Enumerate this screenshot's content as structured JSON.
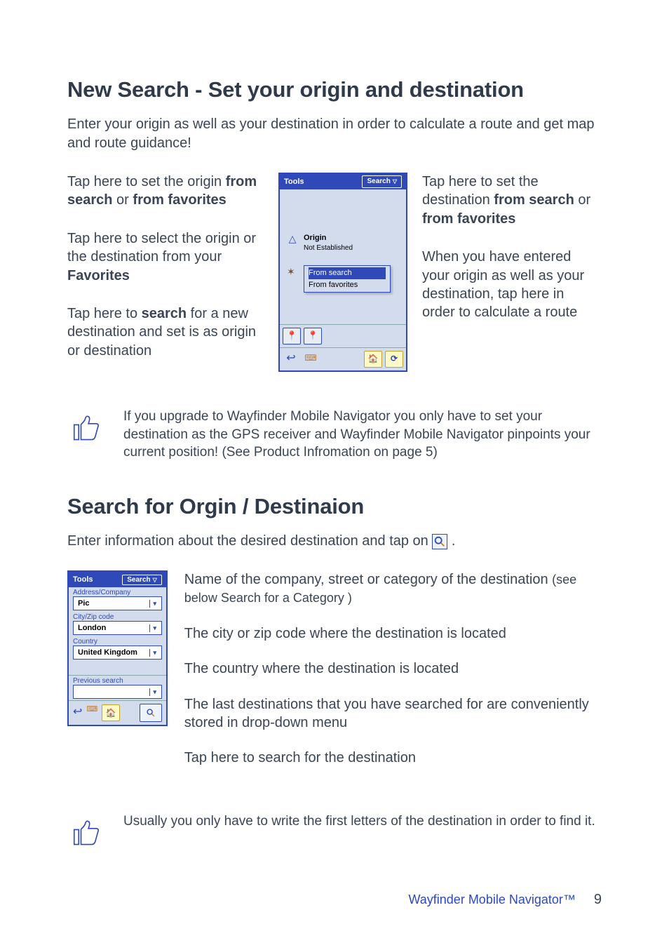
{
  "section1": {
    "heading": "New Search  - Set your origin and destination",
    "intro": "Enter your origin as well as your destination in order to calculate a route and get map and route guidance!",
    "left": {
      "a_pre": "Tap here to set the origin ",
      "a_b1": "from search",
      "a_mid": " or ",
      "a_b2": "from favorites",
      "b_pre": "Tap here to select the origin or the destination from your ",
      "b_b": "Favorites",
      "c_pre": "Tap here to ",
      "c_b": "search",
      "c_post": " for a new destination and set is as origin or destination"
    },
    "right": {
      "a_pre": "Tap here to set the destination ",
      "a_b1": "from search",
      "a_mid": " or ",
      "a_b2": "from favorites",
      "b": "When you have entered your origin as well as your destination, tap here in order to calculate a route"
    },
    "phone": {
      "tools": "Tools",
      "search": "Search",
      "origin_label": "Origin",
      "origin_sub": "Not Established",
      "popup_item1": "From search",
      "popup_item2": "From favorites"
    },
    "tip": "If you upgrade to Wayfinder Mobile Navigator you only have to set your destination as the GPS receiver and Wayfinder Mobile Navigator pinpoints your current position! (See Product Infromation on page 5)"
  },
  "section2": {
    "heading": "Search for Orgin / Destinaion",
    "intro": "Enter information about the desired destination and tap on ",
    "intro_post": ".",
    "phone": {
      "tools": "Tools",
      "search": "Search",
      "addr_label": "Address/Company",
      "addr_value": "Pic",
      "city_label": "City/Zip code",
      "city_value": "London",
      "country_label": "Country",
      "country_value": "United Kingdom",
      "prev_label": "Previous search"
    },
    "notes": {
      "addr_main": "Name of the company, street or category of the destination  ",
      "addr_sub": "(see below Search for a Category )",
      "city": "The city or zip code where the destination is located",
      "country": "The country where the destination is located",
      "prev": "The last destinations that you have searched for are conveniently stored in drop-down menu",
      "search": "Tap here to search for the destination"
    },
    "tip": "Usually you only have to write the first letters of the destination in order to find it."
  },
  "footer": {
    "product": "Wayfinder Mobile Navigator™",
    "page": "9"
  }
}
